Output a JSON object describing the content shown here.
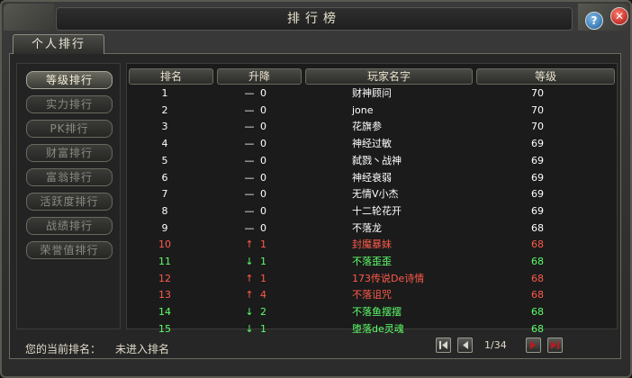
{
  "window": {
    "title": "排行榜",
    "help": "?",
    "close": "✕"
  },
  "tab": {
    "label": "个人排行"
  },
  "sidebar": {
    "items": [
      {
        "label": "等级排行",
        "active": true
      },
      {
        "label": "实力排行",
        "active": false
      },
      {
        "label": "PK排行",
        "active": false
      },
      {
        "label": "财富排行",
        "active": false
      },
      {
        "label": "富翁排行",
        "active": false
      },
      {
        "label": "活跃度排行",
        "active": false
      },
      {
        "label": "战绩排行",
        "active": false
      },
      {
        "label": "荣誉值排行",
        "active": false
      }
    ]
  },
  "table": {
    "headers": {
      "rank": "排名",
      "change": "升降",
      "name": "玩家名字",
      "level": "等级"
    },
    "rows": [
      {
        "rank": "1",
        "dir": "same",
        "delta": "0",
        "name": "财神顾问",
        "level": "70"
      },
      {
        "rank": "2",
        "dir": "same",
        "delta": "0",
        "name": "jone",
        "level": "70"
      },
      {
        "rank": "3",
        "dir": "same",
        "delta": "0",
        "name": "花旗参",
        "level": "70"
      },
      {
        "rank": "4",
        "dir": "same",
        "delta": "0",
        "name": "神经过敏",
        "level": "69"
      },
      {
        "rank": "5",
        "dir": "same",
        "delta": "0",
        "name": "弑戮丶战神",
        "level": "69"
      },
      {
        "rank": "6",
        "dir": "same",
        "delta": "0",
        "name": "神经衰弱",
        "level": "69"
      },
      {
        "rank": "7",
        "dir": "same",
        "delta": "0",
        "name": "无情V小杰",
        "level": "69"
      },
      {
        "rank": "8",
        "dir": "same",
        "delta": "0",
        "name": "十二轮花开",
        "level": "69"
      },
      {
        "rank": "9",
        "dir": "same",
        "delta": "0",
        "name": "不落龙",
        "level": "68"
      },
      {
        "rank": "10",
        "dir": "up",
        "delta": "1",
        "name": "封魔暴妹",
        "level": "68"
      },
      {
        "rank": "11",
        "dir": "down",
        "delta": "1",
        "name": "不落歪歪",
        "level": "68"
      },
      {
        "rank": "12",
        "dir": "up",
        "delta": "1",
        "name": "173传说De诗情",
        "level": "68"
      },
      {
        "rank": "13",
        "dir": "up",
        "delta": "4",
        "name": "不落诅咒",
        "level": "68"
      },
      {
        "rank": "14",
        "dir": "down",
        "delta": "2",
        "name": "不落鱼摆摆",
        "level": "68"
      },
      {
        "rank": "15",
        "dir": "down",
        "delta": "1",
        "name": "堕落de灵魂",
        "level": "68"
      }
    ],
    "dir_glyphs": {
      "same": "—",
      "up": "↑",
      "down": "↓"
    },
    "colors": {
      "same": "#ffffff",
      "up": "#ff5a4a",
      "down": "#5dff6a",
      "level": "#ffffff"
    }
  },
  "footer": {
    "my_rank_label": "您的当前排名：",
    "my_rank_value": "未进入排名",
    "page": "1/34"
  },
  "colors": {
    "accent_red": "#c0181c",
    "text": "#e0dac8"
  }
}
